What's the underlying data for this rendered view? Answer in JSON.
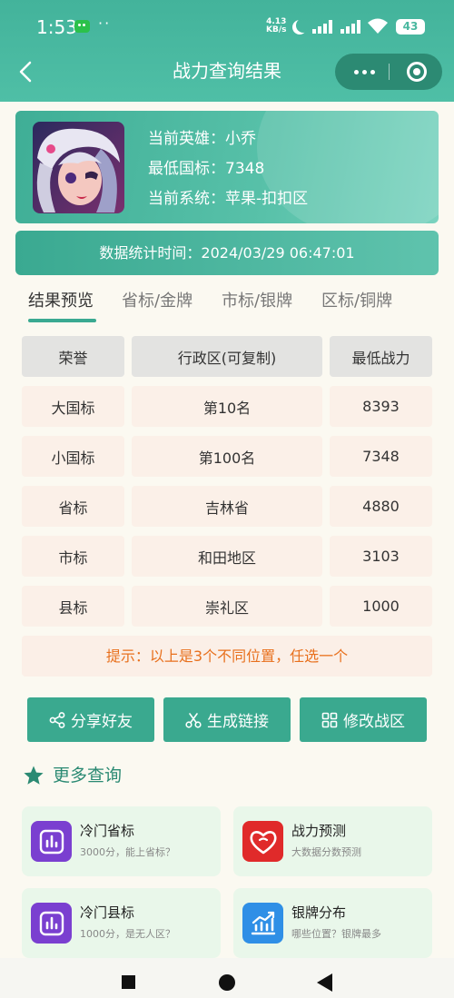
{
  "status_bar": {
    "time": "1:53",
    "dots": "··",
    "net_speed_value": "4.13",
    "net_speed_unit": "KB/s",
    "battery": "43"
  },
  "nav": {
    "title": "战力查询结果"
  },
  "hero": {
    "hero_line": "当前英雄：小乔",
    "min_score_line": "最低国标：7348",
    "system_line": "当前系统：苹果-扣扣区"
  },
  "stats_time": "数据统计时间：2024/03/29 06:47:01",
  "tabs": [
    {
      "label": "结果预览",
      "active": true
    },
    {
      "label": "省标/金牌",
      "active": false
    },
    {
      "label": "市标/银牌",
      "active": false
    },
    {
      "label": "区标/铜牌",
      "active": false
    }
  ],
  "table": {
    "headers": [
      "荣誉",
      "行政区(可复制)",
      "最低战力"
    ],
    "rows": [
      [
        "大国标",
        "第10名",
        "8393"
      ],
      [
        "小国标",
        "第100名",
        "7348"
      ],
      [
        "省标",
        "吉林省",
        "4880"
      ],
      [
        "市标",
        "和田地区",
        "3103"
      ],
      [
        "县标",
        "崇礼区",
        "1000"
      ]
    ]
  },
  "hint": "提示：以上是3个不同位置，任选一个",
  "actions": [
    {
      "label": "分享好友",
      "icon": "share-icon"
    },
    {
      "label": "生成链接",
      "icon": "scissors-icon"
    },
    {
      "label": "修改战区",
      "icon": "grid-icon"
    }
  ],
  "more": {
    "title": "更多查询",
    "cards": [
      {
        "title": "冷门省标",
        "subtitle": "3000分，能上省标？",
        "icon": "bar-chart-icon",
        "color": "#7a3fd0"
      },
      {
        "title": "战力预测",
        "subtitle": "大数据分数预测",
        "icon": "heart-icon",
        "color": "#e02a2a"
      },
      {
        "title": "冷门县标",
        "subtitle": "1000分，是无人区？",
        "icon": "bar-chart-icon",
        "color": "#7a3fd0"
      },
      {
        "title": "银牌分布",
        "subtitle": "哪些位置？银牌最多",
        "icon": "trend-chart-icon",
        "color": "#2f8fe6"
      }
    ]
  },
  "colors": {
    "primary": "#3aa98f",
    "header": "#4ab8a0",
    "hint_text": "#e8701d",
    "capsule": "#2c8a73"
  }
}
